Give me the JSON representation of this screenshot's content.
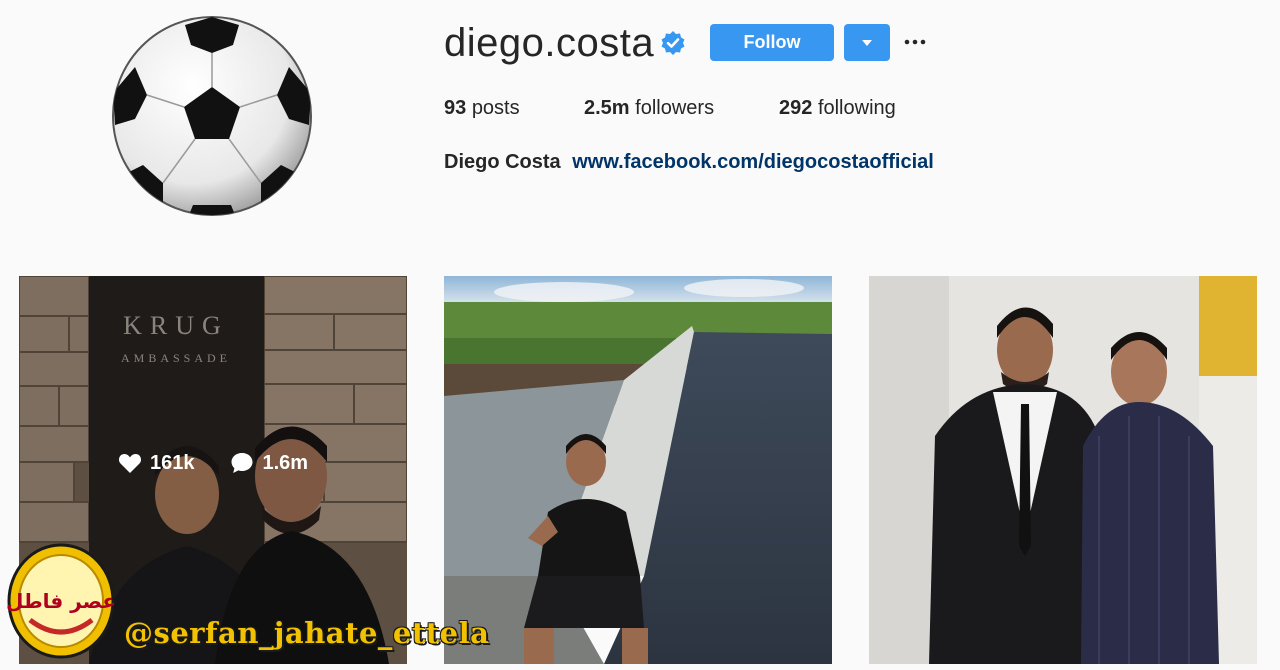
{
  "profile": {
    "username": "diego.costa",
    "verified": true,
    "follow_label": "Follow",
    "stats": {
      "posts_count": "93",
      "posts_label": "posts",
      "followers_count": "2.5m",
      "followers_label": "followers",
      "following_count": "292",
      "following_label": "following"
    },
    "full_name": "Diego Costa",
    "website": "www.facebook.com/diegocostaofficial"
  },
  "posts": [
    {
      "likes": "161k",
      "comments": "1.6m",
      "sign_line1": "KRUG",
      "sign_line2": "AMBASSADE"
    },
    {},
    {}
  ],
  "watermark": {
    "handle": "@serfan_jahate_ettela",
    "logo_text": "عصر فاطل"
  },
  "colors": {
    "accent": "#3897f0",
    "link": "#003569",
    "background": "#fafafa",
    "watermark": "#f2c200"
  },
  "icons": [
    "verified-badge-icon",
    "chevron-down-icon",
    "more-options-icon",
    "heart-icon",
    "comment-icon",
    "soccer-ball-avatar"
  ]
}
